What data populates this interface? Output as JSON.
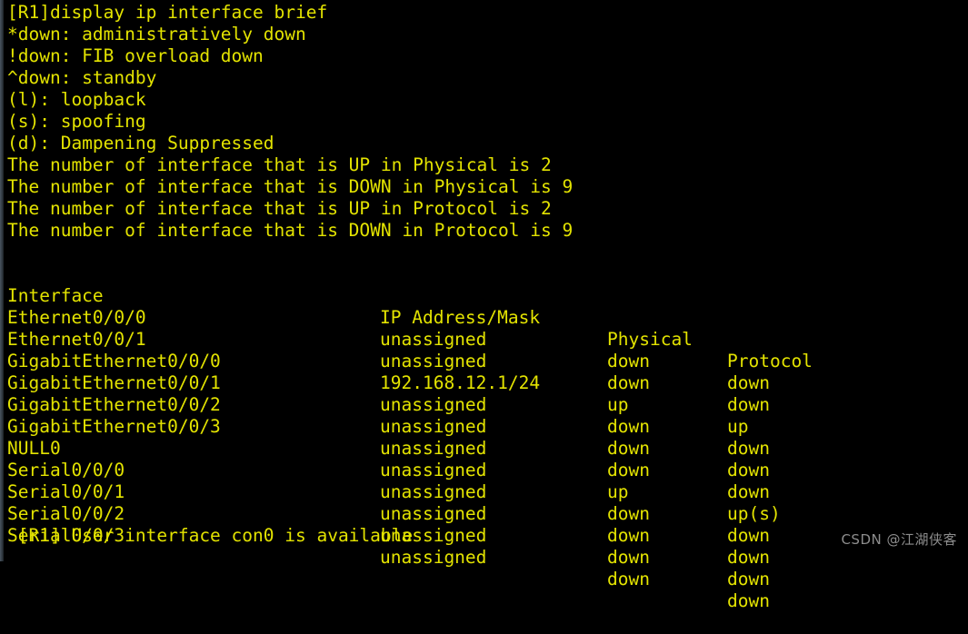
{
  "terminal": {
    "foreground_color": "#e3e300",
    "background_color": "#000000",
    "prompt_line": "[R1]display ip interface brief",
    "legend": [
      "*down: administratively down",
      "!down: FIB overload down",
      "^down: standby",
      "(l): loopback",
      "(s): spoofing",
      "(d): Dampening Suppressed"
    ],
    "summary": [
      "The number of interface that is UP in Physical is 2",
      "The number of interface that is DOWN in Physical is 9",
      "The number of interface that is UP in Protocol is 2",
      "The number of interface that is DOWN in Protocol is 9"
    ],
    "table": {
      "headers": {
        "interface": "Interface",
        "ip": "IP Address/Mask",
        "physical": "Physical",
        "protocol": "Protocol"
      },
      "rows": [
        {
          "interface": "Ethernet0/0/0",
          "ip": "unassigned",
          "physical": "down",
          "protocol": "down"
        },
        {
          "interface": "Ethernet0/0/1",
          "ip": "unassigned",
          "physical": "down",
          "protocol": "down"
        },
        {
          "interface": "GigabitEthernet0/0/0",
          "ip": "192.168.12.1/24",
          "physical": "up",
          "protocol": "up"
        },
        {
          "interface": "GigabitEthernet0/0/1",
          "ip": "unassigned",
          "physical": "down",
          "protocol": "down"
        },
        {
          "interface": "GigabitEthernet0/0/2",
          "ip": "unassigned",
          "physical": "down",
          "protocol": "down"
        },
        {
          "interface": "GigabitEthernet0/0/3",
          "ip": "unassigned",
          "physical": "down",
          "protocol": "down"
        },
        {
          "interface": "NULL0",
          "ip": "unassigned",
          "physical": "up",
          "protocol": "up(s)"
        },
        {
          "interface": "Serial0/0/0",
          "ip": "unassigned",
          "physical": "down",
          "protocol": "down"
        },
        {
          "interface": "Serial0/0/1",
          "ip": "unassigned",
          "physical": "down",
          "protocol": "down"
        },
        {
          "interface": "Serial0/0/2",
          "ip": "unassigned",
          "physical": "down",
          "protocol": "down"
        },
        {
          "interface": "Serial0/0/3",
          "ip": "unassigned",
          "physical": "down",
          "protocol": "down"
        }
      ]
    },
    "status_line": " [R1] User interface con0 is available"
  },
  "watermark": {
    "text": "CSDN @江湖侠客",
    "color": "#8d8d8d"
  }
}
